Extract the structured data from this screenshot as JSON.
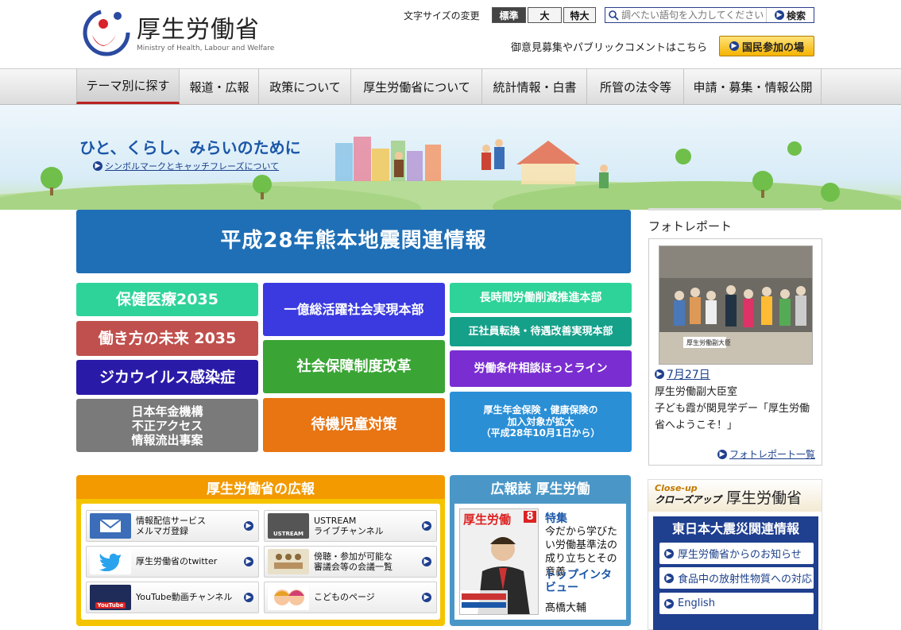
{
  "header": {
    "ministry_name": "厚生労働省",
    "ministry_name_en": "Ministry of Health, Labour and Welfare",
    "font_size_label": "文字サイズの変更",
    "font_sizes": [
      "標準",
      "大",
      "特大"
    ],
    "search": {
      "placeholder": "調べたい語句を入力してください",
      "button": "検索"
    },
    "opinion_link": "御意見募集やパブリックコメントはこちら",
    "participation_button": "国民参加の場"
  },
  "nav": [
    "テーマ別に探す",
    "報道・広報",
    "政策について",
    "厚生労働省について",
    "統計情報・白書",
    "所管の法令等",
    "申請・募集・情報公開"
  ],
  "hero": {
    "catchphrase": "ひと、くらし、みらいのために",
    "symbol_link": "シンボルマークとキャッチフレーズについて"
  },
  "banners": {
    "kumamoto": "平成28年熊本地震関連情報",
    "col1": [
      "保健医療2035",
      "働き方の未来 2035",
      "ジカウイルス感染症",
      "日本年金機構\n不正アクセス\n情報流出事案"
    ],
    "col2": [
      "一億総活躍社会実現本部",
      "社会保障制度改革",
      "待機児童対策"
    ],
    "col3": [
      "長時間労働削減推進本部",
      "正社員転換・待遇改善実現本部",
      "労働条件相談ほっとライン",
      "厚生年金保険・健康保険の\n加入対象が拡大\n（平成28年10月1日から）"
    ]
  },
  "colors": {
    "kumamoto": "#1f6fb6",
    "col1": [
      "#2ed39a",
      "#c0504d",
      "#2a1aa8",
      "#7a7a7a"
    ],
    "col2": [
      "#3a3ae0",
      "#3aa535",
      "#e87412"
    ],
    "col3": [
      "#2ed39a",
      "#15a08a",
      "#7a2ed1",
      "#2b8fd6"
    ]
  },
  "photo_report": {
    "title": "フォトレポート",
    "photo_caption_sign": "厚生労働副大臣",
    "date": "7月27日",
    "caption": "厚生労働副大臣室\n子ども霞が関見学デー「厚生労働省へようこそ！」",
    "more_link": "フォトレポート一覧"
  },
  "pr": {
    "title": "厚生労働省の広報",
    "items": [
      {
        "label": "情報配信サービス\nメルマガ登録",
        "icon": "mail-icon"
      },
      {
        "label": "USTREAM\nライブチャンネル",
        "icon": "ustream-icon",
        "badge": "USTREAM"
      },
      {
        "label": "厚生労働省のtwitter",
        "icon": "twitter-icon"
      },
      {
        "label": "傍聴・参加が可能な\n審議会等の会議一覧",
        "icon": "meeting-icon"
      },
      {
        "label": "YouTube動画チャンネル",
        "icon": "youtube-icon",
        "badge": "YouTube"
      },
      {
        "label": "こどものページ",
        "icon": "kids-icon"
      }
    ]
  },
  "magazine": {
    "title": "広報誌 厚生労働",
    "cover_title": "厚生労働",
    "cover_issue": "8",
    "special_label": "特集",
    "special_text": "今だから学びたい労働基準法の成り立ちとその意義",
    "interview_label": "トップインタビュー",
    "interview_name": "髙橋大輔"
  },
  "closeup": {
    "label_en": "Close-up",
    "label_jp": "クローズアップ",
    "title": "厚生労働省",
    "east_title": "東日本大震災関連情報",
    "east_items": [
      "厚生労働省からのお知らせ",
      "食品中の放射性物質への対応",
      "English"
    ]
  }
}
